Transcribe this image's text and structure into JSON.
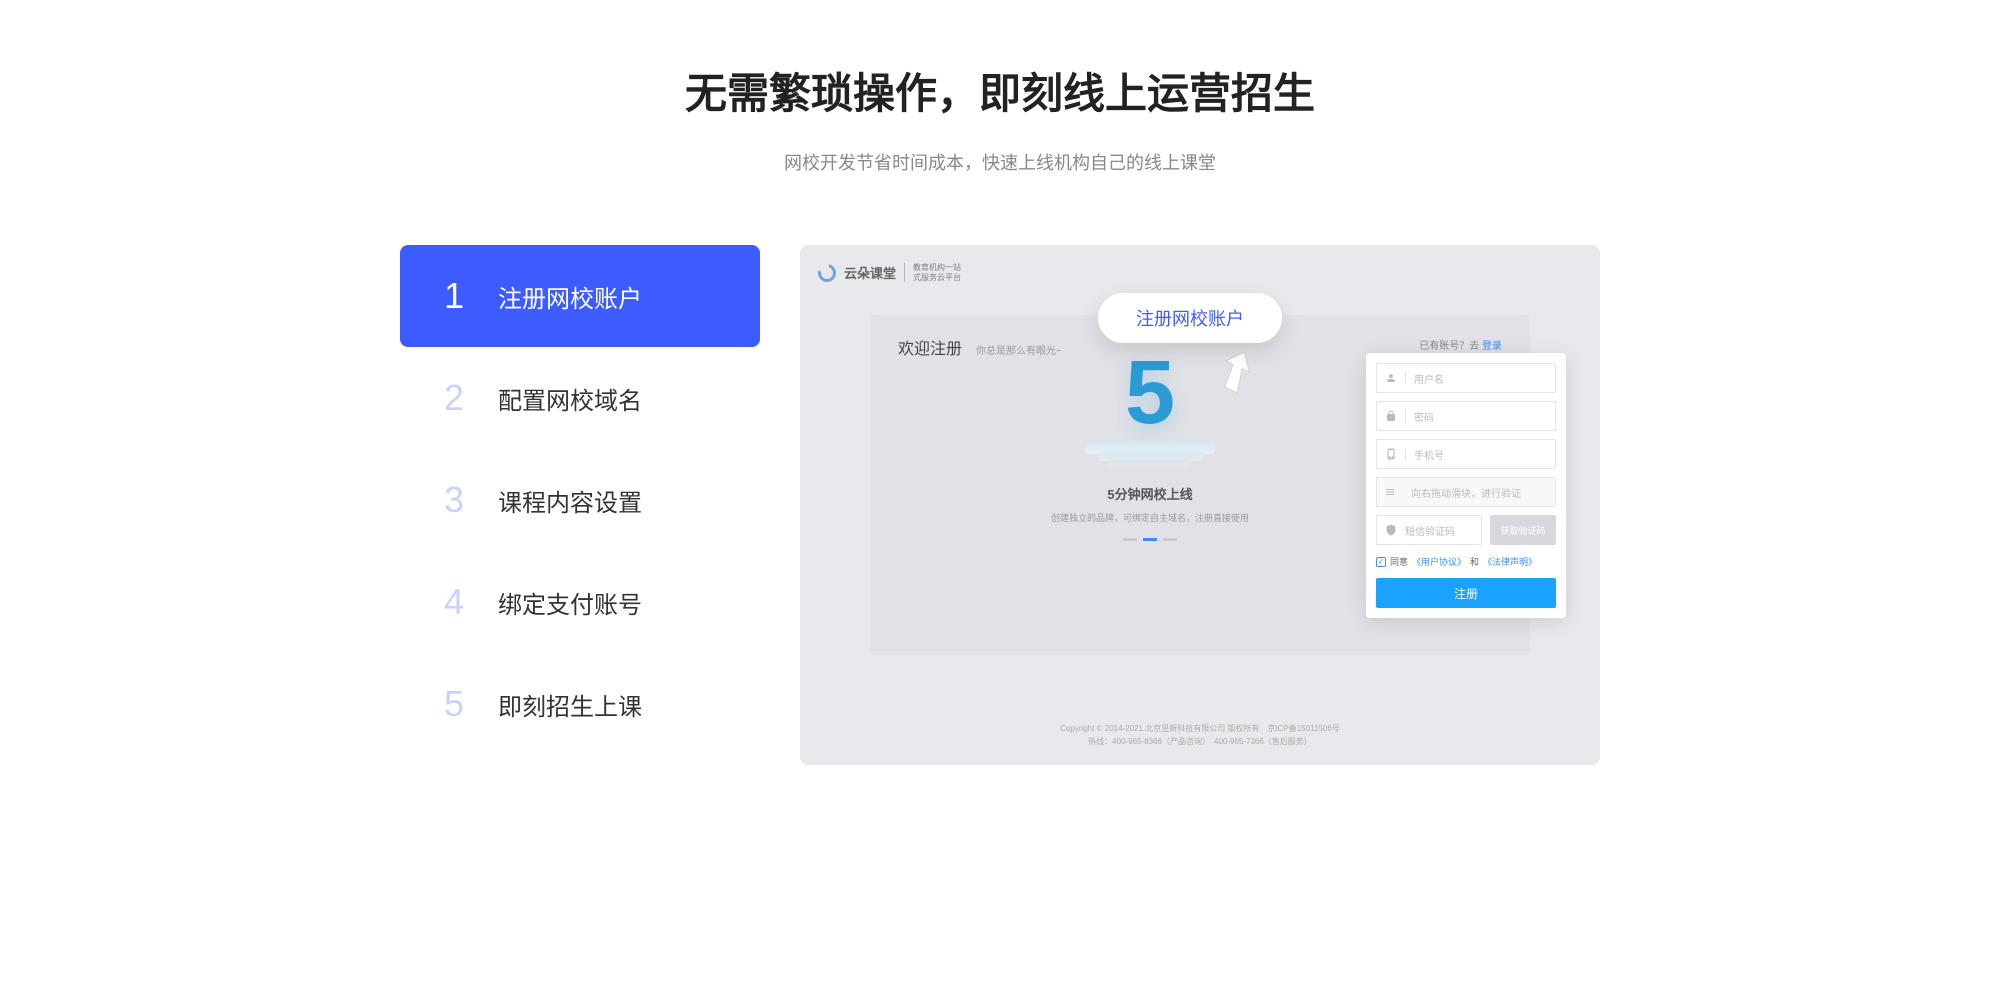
{
  "header": {
    "title": "无需繁琐操作，即刻线上运营招生",
    "subtitle": "网校开发节省时间成本，快速上线机构自己的线上课堂"
  },
  "steps": [
    {
      "number": "1",
      "label": "注册网校账户",
      "active": true
    },
    {
      "number": "2",
      "label": "配置网校域名",
      "active": false
    },
    {
      "number": "3",
      "label": "课程内容设置",
      "active": false
    },
    {
      "number": "4",
      "label": "绑定支付账号",
      "active": false
    },
    {
      "number": "5",
      "label": "即刻招生上课",
      "active": false
    }
  ],
  "preview": {
    "logo_text": "云朵课堂",
    "logo_tag_line1": "教育机构一站",
    "logo_tag_line2": "式服务云平台",
    "welcome": "欢迎注册",
    "welcome_sub": "你总是那么有眼光~",
    "login_hint_prefix": "已有账号？去",
    "login_hint_link": "登录",
    "big_number": "5",
    "five_min_title": "5分钟网校上线",
    "five_min_sub": "创建独立的品牌，可绑定自主域名，注册直接使用",
    "floating_tip": "注册网校账户",
    "form": {
      "username_placeholder": "用户名",
      "password_placeholder": "密码",
      "phone_placeholder": "手机号",
      "slider_text": "向右拖动滑块，进行验证",
      "code_placeholder": "短信验证码",
      "code_btn": "获取验证码",
      "agree_prefix": "同意",
      "agree_link1": "《用户协议》",
      "agree_mid": "和",
      "agree_link2": "《法律声明》",
      "register_btn": "注册"
    },
    "footer_line1": "Copyright © 2014-2021.北京昱新科技有限公司 版权所有　京ICP备15011506号",
    "footer_line2": "热线：400-965-8366（产品咨询）　400-965-7366（售后服务）"
  }
}
